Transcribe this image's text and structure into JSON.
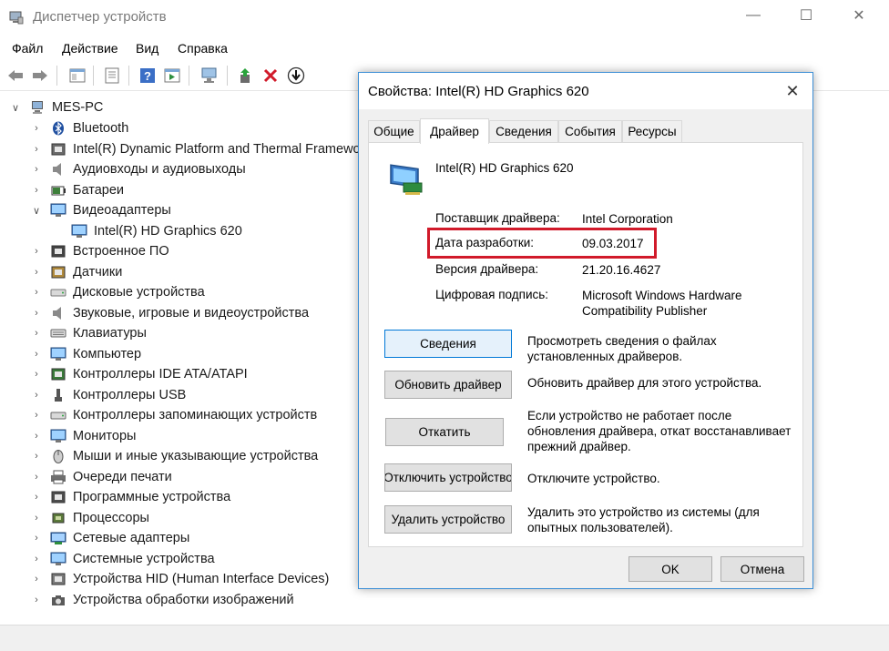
{
  "window": {
    "title": "Диспетчер устройств",
    "min_glyph": "—",
    "max_glyph": "☐",
    "close_glyph": "✕"
  },
  "menu": [
    "Файл",
    "Действие",
    "Вид",
    "Справка"
  ],
  "tree": {
    "root": "MES-PC",
    "items": [
      {
        "label": "Bluetooth",
        "icon": "bluetooth-icon"
      },
      {
        "label": "Intel(R) Dynamic Platform and Thermal Framewo",
        "icon": "chip-icon"
      },
      {
        "label": "Аудиовходы и аудиовыходы",
        "icon": "speaker-icon"
      },
      {
        "label": "Батареи",
        "icon": "battery-icon"
      },
      {
        "label": "Видеоадаптеры",
        "icon": "display-adapter-icon",
        "expanded": true
      },
      {
        "label": "Intel(R) HD Graphics 620",
        "icon": "display-adapter-icon",
        "child": true
      },
      {
        "label": "Встроенное ПО",
        "icon": "firmware-icon"
      },
      {
        "label": "Датчики",
        "icon": "sensor-icon"
      },
      {
        "label": "Дисковые устройства",
        "icon": "disk-icon"
      },
      {
        "label": "Звуковые, игровые и видеоустройства",
        "icon": "speaker-icon"
      },
      {
        "label": "Клавиатуры",
        "icon": "keyboard-icon"
      },
      {
        "label": "Компьютер",
        "icon": "monitor-icon"
      },
      {
        "label": "Контроллеры IDE ATA/ATAPI",
        "icon": "controller-icon"
      },
      {
        "label": "Контроллеры USB",
        "icon": "usb-icon"
      },
      {
        "label": "Контроллеры запоминающих устройств",
        "icon": "storage-icon"
      },
      {
        "label": "Мониторы",
        "icon": "monitor-icon"
      },
      {
        "label": "Мыши и иные указывающие устройства",
        "icon": "mouse-icon"
      },
      {
        "label": "Очереди печати",
        "icon": "printer-icon"
      },
      {
        "label": "Программные устройства",
        "icon": "software-device-icon"
      },
      {
        "label": "Процессоры",
        "icon": "cpu-icon"
      },
      {
        "label": "Сетевые адаптеры",
        "icon": "network-icon"
      },
      {
        "label": "Системные устройства",
        "icon": "system-icon"
      },
      {
        "label": "Устройства HID (Human Interface Devices)",
        "icon": "hid-icon"
      },
      {
        "label": "Устройства обработки изображений",
        "icon": "camera-icon"
      }
    ]
  },
  "dialog": {
    "title": "Свойства: Intel(R) HD Graphics 620",
    "close_glyph": "✕",
    "tabs": [
      "Общие",
      "Драйвер",
      "Сведения",
      "События",
      "Ресурсы"
    ],
    "device_name": "Intel(R) HD Graphics 620",
    "props": {
      "provider_label": "Поставщик драйвера:",
      "provider_value": "Intel Corporation",
      "date_label": "Дата разработки:",
      "date_value": "09.03.2017",
      "version_label": "Версия драйвера:",
      "version_value": "21.20.16.4627",
      "signature_label": "Цифровая подпись:",
      "signature_value_1": "Microsoft Windows Hardware",
      "signature_value_2": "Compatibility Publisher"
    },
    "actions": {
      "details_label": "Сведения",
      "details_desc_1": "Просмотреть сведения о файлах",
      "details_desc_2": "установленных драйверов.",
      "update_label": "Обновить драйвер",
      "update_desc": "Обновить драйвер для этого устройства.",
      "rollback_label": "Откатить",
      "rollback_desc_1": "Если устройство не работает после",
      "rollback_desc_2": "обновления драйвера, откат восстанавливает",
      "rollback_desc_3": "прежний драйвер.",
      "disable_label": "Отключить устройство",
      "disable_desc": "Отключите устройство.",
      "uninstall_label": "Удалить устройство",
      "uninstall_desc_1": "Удалить это устройство из системы (для",
      "uninstall_desc_2": "опытных пользователей)."
    },
    "ok_label": "OK",
    "cancel_label": "Отмена"
  },
  "colors": {
    "highlight": "#d11a2a",
    "dialog_border": "#3c8fd6",
    "accent": "#0078d7"
  }
}
